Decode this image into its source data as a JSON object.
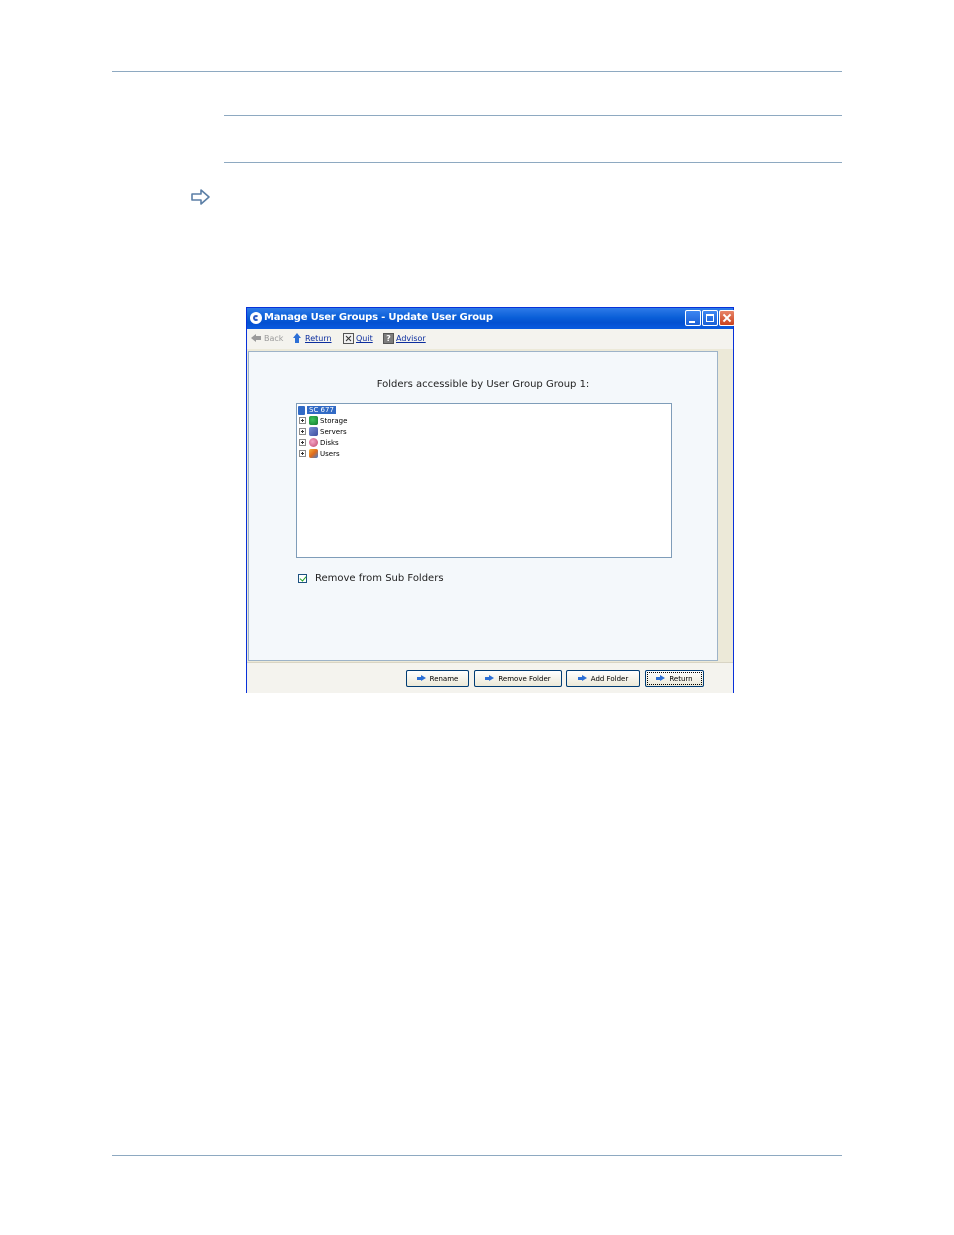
{
  "window": {
    "title": "Manage User Groups - Update User Group"
  },
  "toolbar": {
    "back_label": "Back",
    "return_label": "Return",
    "quit_label": "Quit",
    "advisor_label": "Advisor"
  },
  "content": {
    "heading": "Folders accessible by User Group Group 1:",
    "tree": {
      "root_label": "SC 677",
      "items": [
        {
          "label": "Storage",
          "icon": "storage-icon"
        },
        {
          "label": "Servers",
          "icon": "servers-icon"
        },
        {
          "label": "Disks",
          "icon": "disks-icon"
        },
        {
          "label": "Users",
          "icon": "users-icon"
        }
      ]
    },
    "remove_subfolders_label": "Remove from Sub Folders",
    "remove_subfolders_checked": true
  },
  "buttons": {
    "rename": "Rename",
    "remove_folder": "Remove Folder",
    "add_folder": "Add Folder",
    "return": "Return"
  },
  "colors": {
    "titlebar": "#0a5fd8",
    "selection": "#316ac5",
    "rule": "#8ea9c1"
  }
}
